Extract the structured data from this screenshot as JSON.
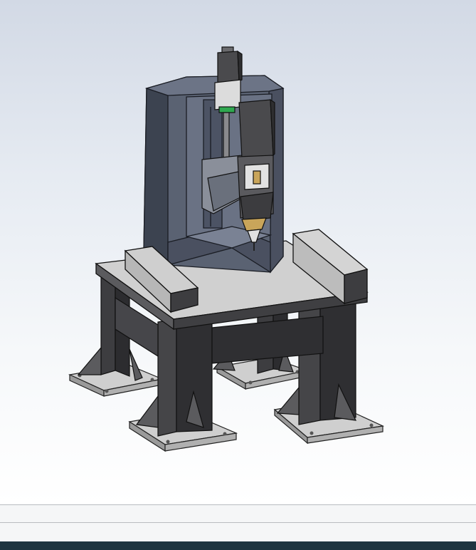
{
  "viewport": {
    "background_top": "#d2d9e5",
    "background_bottom": "#ffffff"
  },
  "model": {
    "subject": "cnc-machine-assembly",
    "colors": {
      "column": "#5a6272",
      "column_dark": "#3c4350",
      "table_top": "#cfcfcf",
      "frame": "#3d3d40",
      "frame_light": "#5b5b5e",
      "feet": "#c8c8c8",
      "motor": "#4a4a4d",
      "brass": "#c9a55a",
      "green_coupler": "#2fa84f"
    }
  },
  "statusbar": {
    "color": "#1f3540"
  }
}
